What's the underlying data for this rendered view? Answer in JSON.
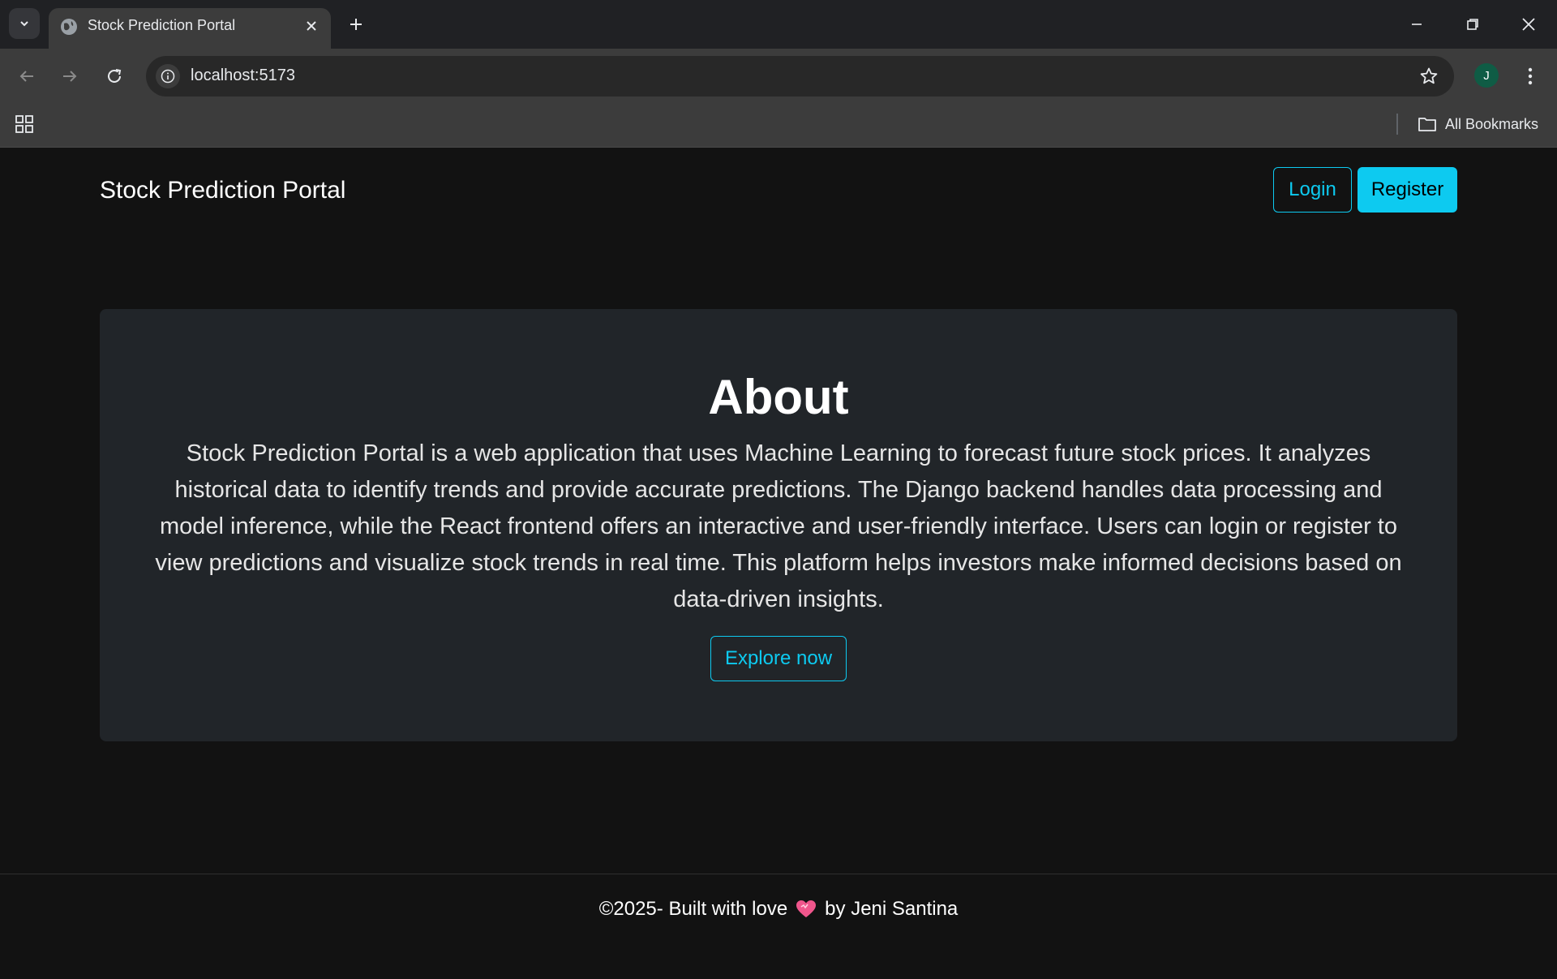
{
  "browser": {
    "tab_title": "Stock Prediction Portal",
    "url": "localhost:5173",
    "profile_initial": "J",
    "bookmarks_label": "All Bookmarks"
  },
  "navbar": {
    "brand": "Stock Prediction Portal",
    "login_label": "Login",
    "register_label": "Register"
  },
  "about": {
    "title": "About",
    "description": "Stock Prediction Portal is a web application that uses Machine Learning to forecast future stock prices. It analyzes historical data to identify trends and provide accurate predictions. The Django backend handles data processing and model inference, while the React frontend offers an interactive and user-friendly interface. Users can login or register to view predictions and visualize stock trends in real time. This platform helps investors make informed decisions based on data-driven insights.",
    "cta_label": "Explore now"
  },
  "footer": {
    "prefix": "©2025- Built with love",
    "suffix": "by Jeni Santina"
  },
  "colors": {
    "accent": "#0dcaf0",
    "page_bg": "#121212",
    "card_bg": "#212529"
  }
}
